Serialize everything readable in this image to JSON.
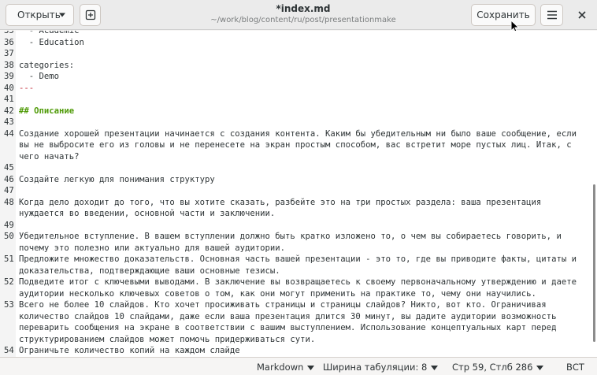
{
  "header": {
    "open_label": "Открыть",
    "title": "*index.md",
    "subtitle": "~/work/blog/content/ru/post/presentationmake",
    "save_label": "Сохранить",
    "open_icon": "chevron-down-icon",
    "new_tab_icon": "new-tab-icon",
    "menu_icon": "hamburger-menu-icon",
    "close_icon": "close-icon"
  },
  "editor": {
    "lines": [
      {
        "num": "35",
        "text": "  - Academic",
        "style": "normal"
      },
      {
        "num": "36",
        "text": "  - Education",
        "style": "normal"
      },
      {
        "num": "37",
        "text": "",
        "style": "normal"
      },
      {
        "num": "38",
        "text": "categories:",
        "style": "normal"
      },
      {
        "num": "39",
        "text": "  - Demo",
        "style": "normal"
      },
      {
        "num": "40",
        "text": "---",
        "style": "dashes"
      },
      {
        "num": "41",
        "text": "",
        "style": "normal"
      },
      {
        "num": "42",
        "text": "## Описание",
        "style": "heading"
      },
      {
        "num": "43",
        "text": "",
        "style": "normal"
      },
      {
        "num": "44",
        "text": "Создание хорошей презентации начинается с создания контента. Каким бы убедительным ни было ваше сообщение, если",
        "style": "normal"
      },
      {
        "num": "",
        "text": "вы не выбросите его из головы и не перенесете на экран простым способом, вас встретит море пустых лиц. Итак, с",
        "style": "normal"
      },
      {
        "num": "",
        "text": "чего начать?",
        "style": "normal"
      },
      {
        "num": "45",
        "text": "",
        "style": "normal"
      },
      {
        "num": "46",
        "text": "Создайте легкую для понимания структуру",
        "style": "normal"
      },
      {
        "num": "47",
        "text": "",
        "style": "normal"
      },
      {
        "num": "48",
        "text": "Когда дело доходит до того, что вы хотите сказать, разбейте это на три простых раздела: ваша презентация",
        "style": "normal"
      },
      {
        "num": "",
        "text": "нуждается во введении, основной части и заключении.",
        "style": "normal"
      },
      {
        "num": "49",
        "text": "",
        "style": "normal"
      },
      {
        "num": "50",
        "text": "Убедительное вступление. В вашем вступлении должно быть кратко изложено то, о чем вы собираетесь говорить, и",
        "style": "normal"
      },
      {
        "num": "",
        "text": "почему это полезно или актуально для вашей аудитории.",
        "style": "normal"
      },
      {
        "num": "51",
        "text": "Предложите множество доказательств. Основная часть вашей презентации - это то, где вы приводите факты, цитаты и",
        "style": "normal"
      },
      {
        "num": "",
        "text": "доказательства, подтверждающие ваши основные тезисы.",
        "style": "normal"
      },
      {
        "num": "52",
        "text": "Подведите итог с ключевыми выводами. В заключение вы возвращаетесь к своему первоначальному утверждению и даете",
        "style": "normal"
      },
      {
        "num": "",
        "text": "аудитории несколько ключевых советов о том, как они могут применить на практике то, чему они научились.",
        "style": "normal"
      },
      {
        "num": "53",
        "text": "Всего не более 10 слайдов. Кто хочет просиживать страницы и страницы слайдов? Никто, вот кто. Ограничивая",
        "style": "normal"
      },
      {
        "num": "",
        "text": "количество слайдов 10 слайдами, даже если ваша презентация длится 30 минут, вы дадите аудитории возможность",
        "style": "normal"
      },
      {
        "num": "",
        "text": "переварить сообщения на экране в соответствии с вашим выступлением. Использование концептуальных карт перед",
        "style": "normal"
      },
      {
        "num": "",
        "text": "структурированием слайдов может помочь придерживаться сути.",
        "style": "normal"
      },
      {
        "num": "54",
        "text": "Ограничьте количество копий на каждом слайде",
        "style": "normal"
      }
    ]
  },
  "statusbar": {
    "language": "Markdown",
    "tab_width": "Ширина табуляции: 8",
    "position": "Стр 59, Стлб 286",
    "insert_mode": "ВСТ"
  }
}
